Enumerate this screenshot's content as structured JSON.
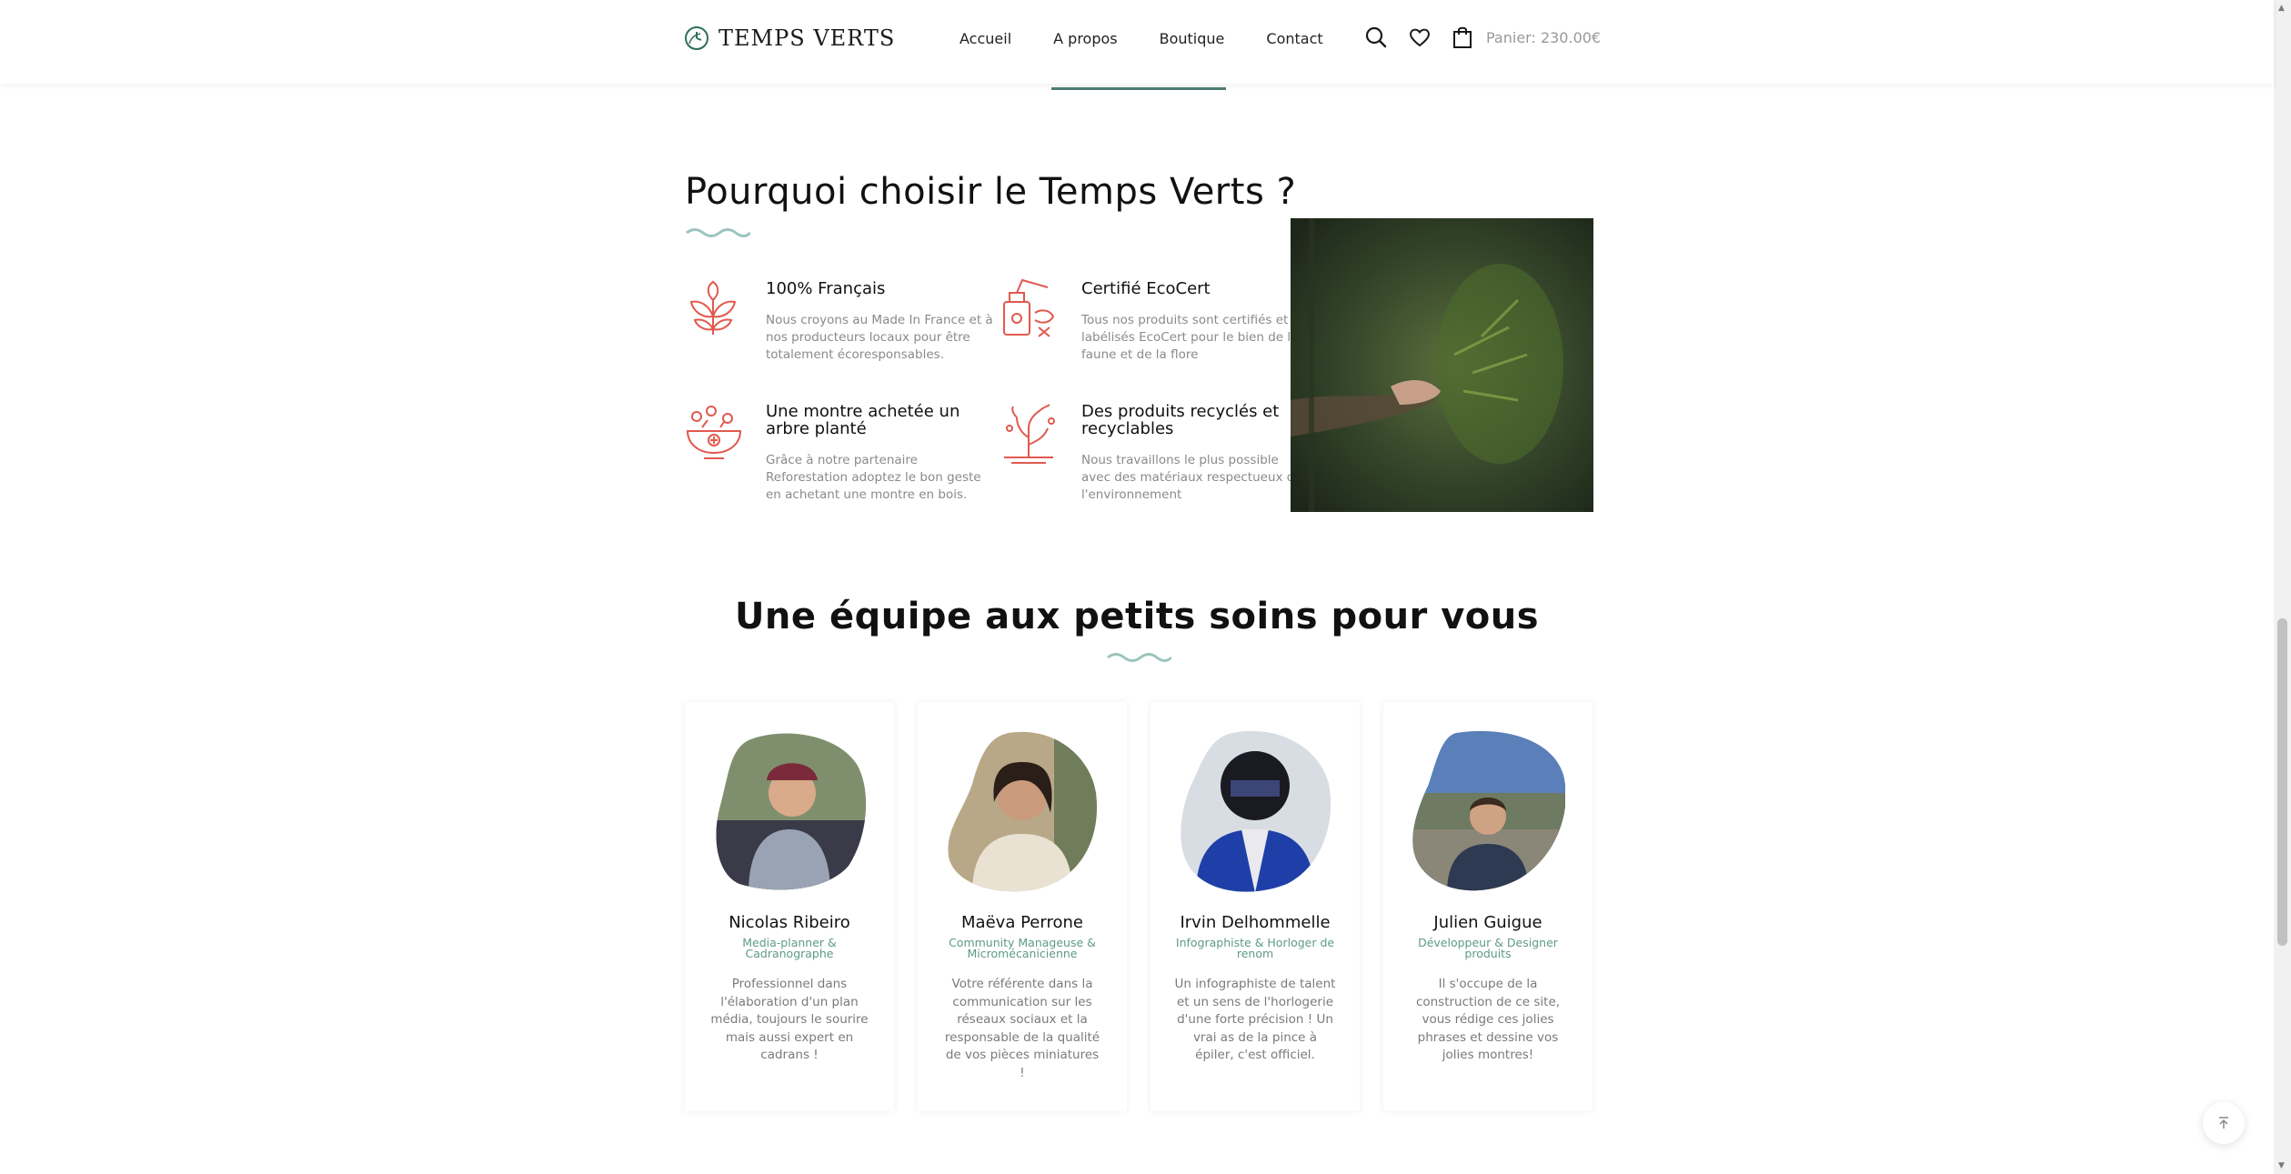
{
  "header": {
    "brand": "TEMPS VERTS",
    "nav": [
      "Accueil",
      "A propos",
      "Boutique",
      "Contact"
    ],
    "cart_label": "Panier: 230.00€"
  },
  "why": {
    "title": "Pourquoi choisir le Temps Verts ?",
    "features": [
      {
        "title": "100% Français",
        "text": "Nous croyons au Made In France et à nos producteurs locaux pour être totalement écoresponsables."
      },
      {
        "title": "Certifié EcoCert",
        "text": "Tous nos produits sont certifiés et labélisés EcoCert pour le bien de la faune et de la flore"
      },
      {
        "title": "Une montre achetée un arbre planté",
        "text": "Grâce à notre partenaire Reforestation adoptez le bon geste en achetant une montre en bois."
      },
      {
        "title": "Des produits recyclés et recyclables",
        "text": "Nous travaillons le plus possible avec des matériaux respectueux de l'environnement"
      }
    ]
  },
  "team": {
    "title": "Une équipe aux petits soins pour vous",
    "members": [
      {
        "name": "Nicolas Ribeiro",
        "role": "Media-planner & Cadranographe",
        "desc": "Professionnel dans l'élaboration d'un plan média, toujours le sourire mais aussi expert en cadrans !"
      },
      {
        "name": "Maëva Perrone",
        "role": "Community Manageuse & Micromécanicienne",
        "desc": "Votre référente dans la communication sur les réseaux sociaux et la responsable de la qualité de vos pièces miniatures !"
      },
      {
        "name": "Irvin Delhommelle",
        "role": "Infographiste & Horloger de renom",
        "desc": "Un infographiste de talent et un sens de l'horlogerie d'une forte précision ! Un vrai as de la pince à épiler, c'est officiel."
      },
      {
        "name": "Julien Guigue",
        "role": "Développeur & Designer produits",
        "desc": "Il s'occupe de la construction de ce site, vous rédige ces jolies phrases et dessine vos jolies montres!"
      }
    ]
  },
  "colors": {
    "accent": "#4e7d74",
    "icon": "#e05a4e",
    "wave": "#9cc4bc"
  },
  "icons": {
    "search": "search-icon",
    "wishlist": "heart-icon",
    "cart": "shopping-bag-icon",
    "back_to_top": "arrow-up-icon"
  }
}
